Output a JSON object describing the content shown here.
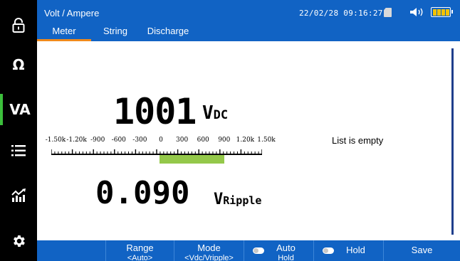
{
  "header": {
    "title": "Volt / Ampere",
    "datetime": "22/02/28 09:16:27",
    "tabs": [
      {
        "label": "Meter",
        "active": true
      },
      {
        "label": "String",
        "active": false
      },
      {
        "label": "Discharge",
        "active": false
      }
    ]
  },
  "sidebar": {
    "items": [
      {
        "icon": "lock-icon"
      },
      {
        "icon": "ohm-icon",
        "label": "Ω"
      },
      {
        "icon": "va-icon",
        "label": "VA",
        "active": true
      },
      {
        "icon": "list-icon"
      },
      {
        "icon": "chart-icon"
      },
      {
        "icon": "gear-icon"
      }
    ]
  },
  "measurement": {
    "main_value": "1001",
    "main_unit": "V",
    "main_unit_sub": "DC",
    "ripple_value": "0.090",
    "ripple_unit": "V",
    "ripple_unit_sub": "Ripple"
  },
  "scale": {
    "tick_labels": [
      "-1.50k",
      "-1.20k",
      "-900",
      "-600",
      "-300",
      "0",
      "300",
      "600",
      "900",
      "1.20k",
      "1.50k"
    ],
    "min": -1500,
    "max": 1500,
    "bar_value": 1001,
    "bar_color": "#94c84a"
  },
  "list": {
    "empty_text": "List is empty"
  },
  "softkeys": {
    "range_line1": "Range",
    "range_line2": "<Auto>",
    "mode_line1": "Mode",
    "mode_line2": "<Vdc/Vripple>",
    "autohold_line1": "Auto",
    "autohold_line2": "Hold",
    "hold_label": "Hold",
    "save_label": "Save"
  },
  "colors": {
    "header_blue": "#1163c4",
    "tab_underline": "#f08a1c",
    "active_accent": "#3cbf3c",
    "battery": "#f2c200"
  }
}
